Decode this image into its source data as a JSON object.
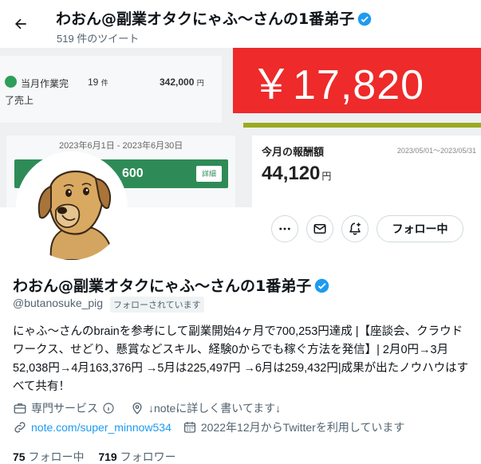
{
  "header": {
    "back_icon": "arrow-left-icon",
    "name": "わおん@副業オタクにゃふ〜さんの1番弟子",
    "tweet_count": "519 件のツイート"
  },
  "banner": {
    "card1": {
      "col1": "当月作業完",
      "col2": "19",
      "col2_unit": "件",
      "col3": "342,000",
      "col3_unit": "円",
      "sub": "了売上"
    },
    "red_amount": "￥17,820",
    "card3": {
      "date_range": "2023年6月1日 - 2023年6月30日",
      "amount_partial": "600",
      "detail_label": "詳細"
    },
    "card4": {
      "title": "今月の報酬額",
      "date_range": "2023/05/01〜2023/05/31",
      "amount": "44,120",
      "unit": "円"
    }
  },
  "actions": {
    "more_icon": "more-horizontal-icon",
    "message_icon": "envelope-icon",
    "notify_icon": "bell-plus-icon",
    "follow_label": "フォロー中"
  },
  "profile": {
    "name": "わおん@副業オタクにゃふ〜さんの1番弟子",
    "handle": "@butanosuke_pig",
    "follows_you": "フォローされています",
    "bio": "にゃふ〜さんのbrainを参考にして副業開始4ヶ月で700,253円達成 |【座談会、クラウドワークス、せどり、懸賞などスキル、経験0からでも稼ぐ方法を発信】| 2月0円→3月52,038円→4月163,376円 →5月は225,497円 →6月は259,432円|成果が出たノウハウはすべて共有！",
    "category": "専門サービス",
    "location": "↓noteに詳しく書いてます↓",
    "url": "note.com/super_minnow534",
    "joined": "2022年12月からTwitterを利用しています",
    "following_count": "75",
    "following_label": "フォロー中",
    "followers_count": "719",
    "followers_label": "フォロワー"
  },
  "colors": {
    "accent": "#1d9bf0",
    "verified": "#1d9bf0",
    "red_card": "#ee2a2a",
    "green": "#2e8b57"
  }
}
